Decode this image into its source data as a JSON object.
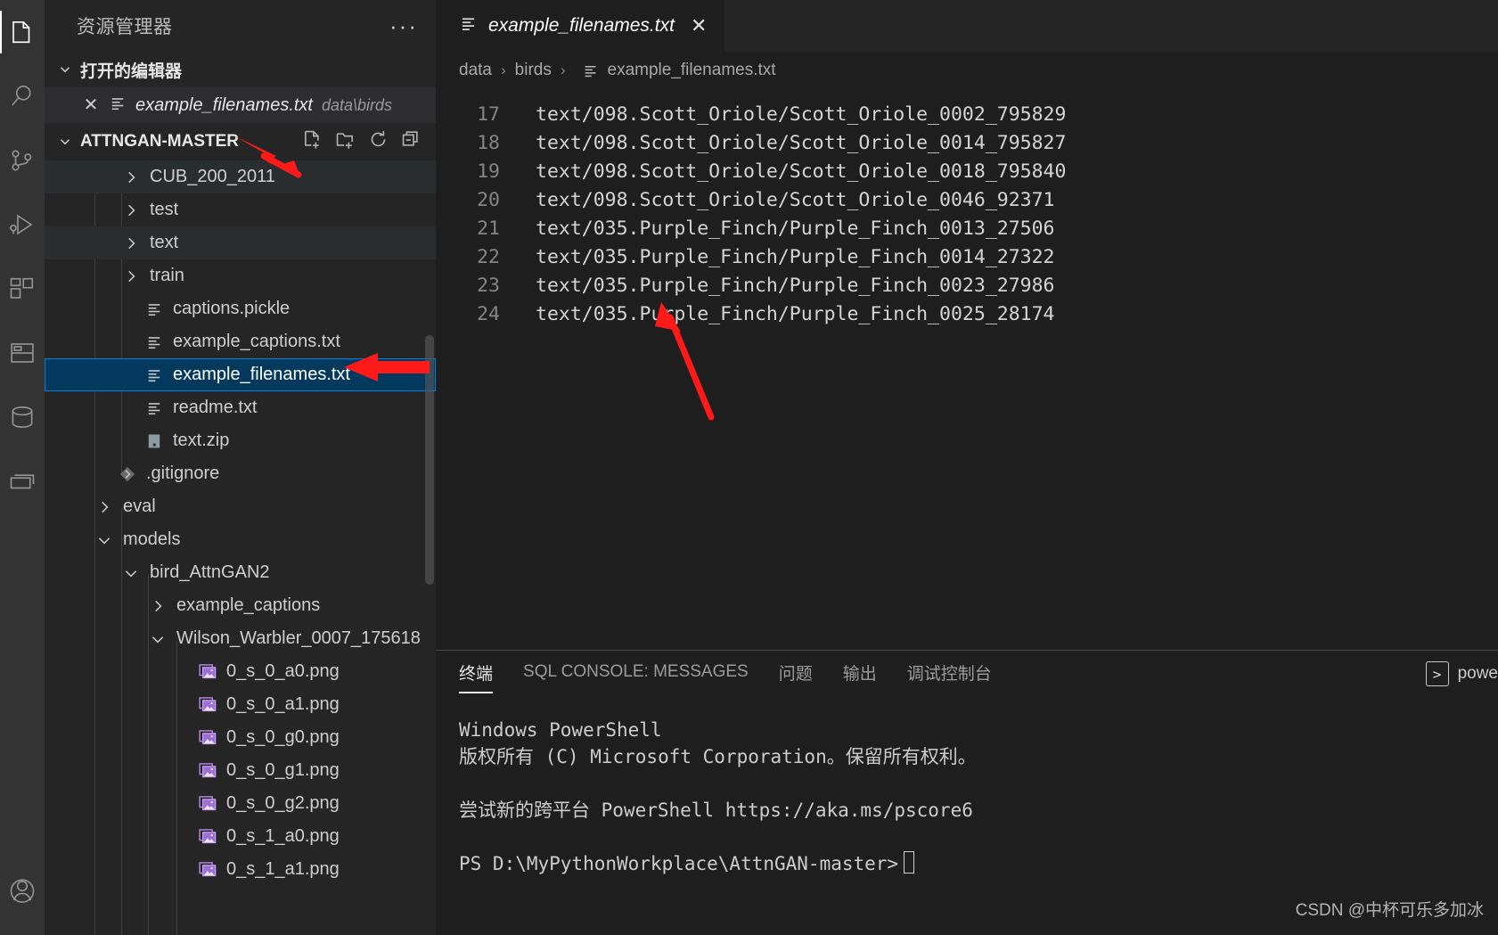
{
  "activity_bar": {
    "items": [
      {
        "name": "explorer-icon",
        "label": "资源管理器",
        "active": true
      },
      {
        "name": "search-icon",
        "label": "搜索",
        "active": false
      },
      {
        "name": "source-control-icon",
        "label": "源代码管理",
        "active": false
      },
      {
        "name": "run-debug-icon",
        "label": "运行和调试",
        "active": false
      },
      {
        "name": "extensions-icon",
        "label": "扩展",
        "active": false
      },
      {
        "name": "table-icon",
        "label": "表",
        "active": false
      },
      {
        "name": "database-icon",
        "label": "数据库",
        "active": false
      },
      {
        "name": "sql-history-icon",
        "label": "SQL 历史",
        "active": false
      }
    ],
    "account_label": "账户"
  },
  "sidebar": {
    "title": "资源管理器",
    "more_actions": "···",
    "open_editors": {
      "label": "打开的编辑器",
      "items": [
        {
          "close": "✕",
          "name": "example_filenames.txt",
          "path": "data\\birds",
          "icon": "text-file-icon"
        }
      ]
    },
    "workspace": {
      "label": "ATTNGAN-MASTER",
      "actions": [
        "new-file-icon",
        "new-folder-icon",
        "refresh-icon",
        "collapse-all-icon"
      ]
    },
    "tree": [
      {
        "label": "CUB_200_2011",
        "type": "folder",
        "expanded": false,
        "depth": 2,
        "icon": "chevron-right-icon"
      },
      {
        "label": "test",
        "type": "folder",
        "expanded": false,
        "depth": 2,
        "icon": "chevron-right-icon"
      },
      {
        "label": "text",
        "type": "folder",
        "expanded": false,
        "depth": 2,
        "icon": "chevron-right-icon"
      },
      {
        "label": "train",
        "type": "folder",
        "expanded": false,
        "depth": 2,
        "icon": "chevron-right-icon"
      },
      {
        "label": "captions.pickle",
        "type": "file",
        "depth": 2,
        "icon": "text-file-icon"
      },
      {
        "label": "example_captions.txt",
        "type": "file",
        "depth": 2,
        "icon": "text-file-icon"
      },
      {
        "label": "example_filenames.txt",
        "type": "file",
        "depth": 2,
        "icon": "text-file-icon",
        "selected": true
      },
      {
        "label": "readme.txt",
        "type": "file",
        "depth": 2,
        "icon": "text-file-icon"
      },
      {
        "label": "text.zip",
        "type": "file",
        "depth": 2,
        "icon": "zip-file-icon"
      },
      {
        "label": ".gitignore",
        "type": "file",
        "depth": 1,
        "icon": "git-icon"
      },
      {
        "label": "eval",
        "type": "folder",
        "expanded": false,
        "depth": 1,
        "icon": "chevron-right-icon"
      },
      {
        "label": "models",
        "type": "folder",
        "expanded": true,
        "depth": 1,
        "icon": "chevron-down-icon"
      },
      {
        "label": "bird_AttnGAN2",
        "type": "folder",
        "expanded": true,
        "depth": 2,
        "icon": "chevron-down-icon"
      },
      {
        "label": "example_captions",
        "type": "folder",
        "expanded": false,
        "depth": 3,
        "icon": "chevron-right-icon"
      },
      {
        "label": "Wilson_Warbler_0007_175618",
        "type": "folder",
        "expanded": true,
        "depth": 3,
        "icon": "chevron-down-icon"
      },
      {
        "label": "0_s_0_a0.png",
        "type": "file",
        "depth": 4,
        "icon": "image-file-icon"
      },
      {
        "label": "0_s_0_a1.png",
        "type": "file",
        "depth": 4,
        "icon": "image-file-icon"
      },
      {
        "label": "0_s_0_g0.png",
        "type": "file",
        "depth": 4,
        "icon": "image-file-icon"
      },
      {
        "label": "0_s_0_g1.png",
        "type": "file",
        "depth": 4,
        "icon": "image-file-icon"
      },
      {
        "label": "0_s_0_g2.png",
        "type": "file",
        "depth": 4,
        "icon": "image-file-icon"
      },
      {
        "label": "0_s_1_a0.png",
        "type": "file",
        "depth": 4,
        "icon": "image-file-icon"
      },
      {
        "label": "0_s_1_a1.png",
        "type": "file",
        "depth": 4,
        "icon": "image-file-icon"
      }
    ]
  },
  "editor": {
    "tab": {
      "label": "example_filenames.txt",
      "icon": "text-file-icon",
      "close": "✕"
    },
    "breadcrumb": [
      {
        "label": "data",
        "icon": null
      },
      {
        "label": "birds",
        "icon": null
      },
      {
        "label": "example_filenames.txt",
        "icon": "text-file-icon"
      }
    ],
    "breadcrumb_separator": "›",
    "lines": [
      {
        "num": "17",
        "text": "text/098.Scott_Oriole/Scott_Oriole_0002_795829"
      },
      {
        "num": "18",
        "text": "text/098.Scott_Oriole/Scott_Oriole_0014_795827"
      },
      {
        "num": "19",
        "text": "text/098.Scott_Oriole/Scott_Oriole_0018_795840"
      },
      {
        "num": "20",
        "text": "text/098.Scott_Oriole/Scott_Oriole_0046_92371"
      },
      {
        "num": "21",
        "text": "text/035.Purple_Finch/Purple_Finch_0013_27506"
      },
      {
        "num": "22",
        "text": "text/035.Purple_Finch/Purple_Finch_0014_27322"
      },
      {
        "num": "23",
        "text": "text/035.Purple_Finch/Purple_Finch_0023_27986"
      },
      {
        "num": "24",
        "text": "text/035.Purple_Finch/Purple_Finch_0025_28174"
      }
    ]
  },
  "panel": {
    "tabs": [
      {
        "label": "终端",
        "active": true
      },
      {
        "label": "SQL CONSOLE: MESSAGES",
        "active": false
      },
      {
        "label": "问题",
        "active": false
      },
      {
        "label": "输出",
        "active": false
      },
      {
        "label": "调试控制台",
        "active": false
      }
    ],
    "shell_selector": {
      "icon": "terminal-icon",
      "label": "powe"
    },
    "terminal_lines": [
      "Windows PowerShell",
      "版权所有 (C) Microsoft Corporation。保留所有权利。",
      "",
      "尝试新的跨平台 PowerShell https://aka.ms/pscore6",
      "",
      "PS D:\\MyPythonWorkplace\\AttnGAN-master>"
    ],
    "prompt_cursor": "▯"
  },
  "watermark": "CSDN @中杯可乐多加冰",
  "colors": {
    "accent": "#007fd4",
    "selection_bg": "#04395e",
    "activity_bar_bg": "#333333",
    "sidebar_bg": "#252526",
    "editor_bg": "#1e1e1e",
    "annotation_red": "#ff1a1a"
  }
}
